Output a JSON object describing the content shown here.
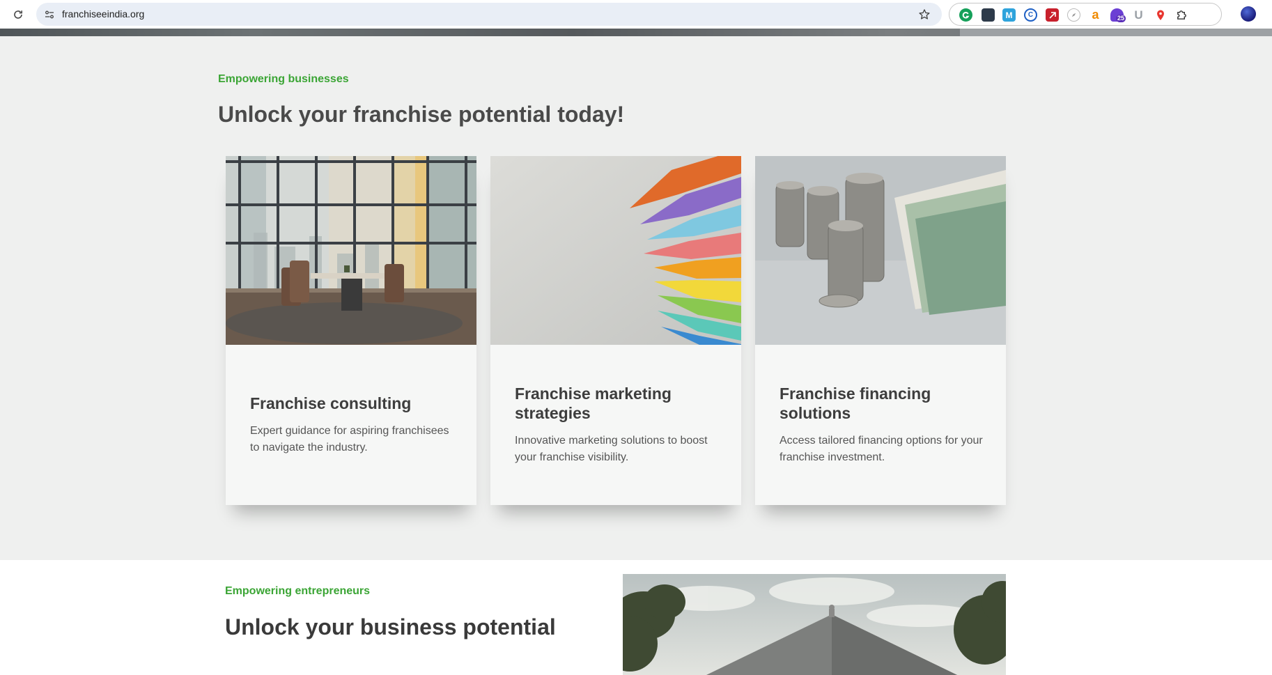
{
  "browser": {
    "url": "franchiseeindia.org",
    "extension_badge_count": "25",
    "extension_letter_a": "a",
    "extension_letter_u": "U",
    "extension_letter_m": "M",
    "extension_letter_c": "C"
  },
  "services": {
    "eyebrow": "Empowering businesses",
    "title": "Unlock your franchise potential today!",
    "cards": [
      {
        "title": "Franchise consulting",
        "text": "Expert guidance for aspiring franchisees to navigate the industry.",
        "image_icon": "office-meeting-room-image"
      },
      {
        "title": "Franchise marketing strategies",
        "text": "Innovative marketing solutions to boost your franchise visibility.",
        "image_icon": "colored-pencils-image"
      },
      {
        "title": "Franchise financing solutions",
        "text": "Access tailored financing options for your franchise investment.",
        "image_icon": "coins-and-cash-image"
      }
    ]
  },
  "about": {
    "eyebrow": "Empowering entrepreneurs",
    "title": "Unlock your business potential",
    "image_icon": "house-roof-image"
  },
  "colors": {
    "accent_green": "#3ba535",
    "section_bg": "#eff0ef",
    "heading": "#4a4a4a"
  }
}
